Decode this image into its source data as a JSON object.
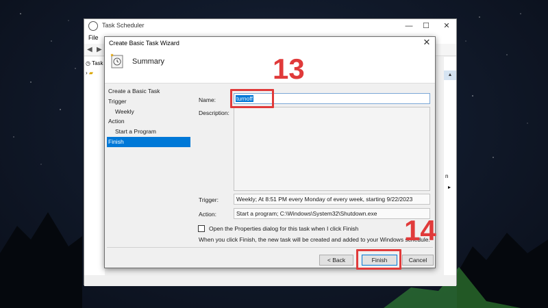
{
  "outer_window": {
    "title": "Task Scheduler",
    "menu_file": "File",
    "tree_item": "Task",
    "minimize": "—",
    "maximize": "☐",
    "close": "✕"
  },
  "wizard": {
    "title": "Create Basic Task Wizard",
    "close": "✕",
    "header_title": "Summary",
    "steps": [
      {
        "label": "Create a Basic Task"
      },
      {
        "label": "Trigger"
      },
      {
        "label": "Weekly"
      },
      {
        "label": "Action"
      },
      {
        "label": "Start a Program"
      },
      {
        "label": "Finish"
      }
    ],
    "name_label": "Name:",
    "name_value": "turnoff",
    "description_label": "Description:",
    "trigger_label": "Trigger:",
    "trigger_value": "Weekly; At 8:51 PM every Monday of every week, starting 9/22/2023",
    "action_label": "Action:",
    "action_value": "Start a program; C:\\Windows\\System32\\Shutdown.exe",
    "checkbox_label": "Open the Properties dialog for this task when I click Finish",
    "note": "When you click Finish, the new task will be created and added to your Windows schedule.",
    "back_button": "< Back",
    "finish_button": "Finish",
    "cancel_button": "Cancel"
  },
  "annotations": {
    "step_13": "13",
    "step_14": "14",
    "color": "#e03a3a"
  },
  "colors": {
    "selection_blue": "#0078d7"
  }
}
